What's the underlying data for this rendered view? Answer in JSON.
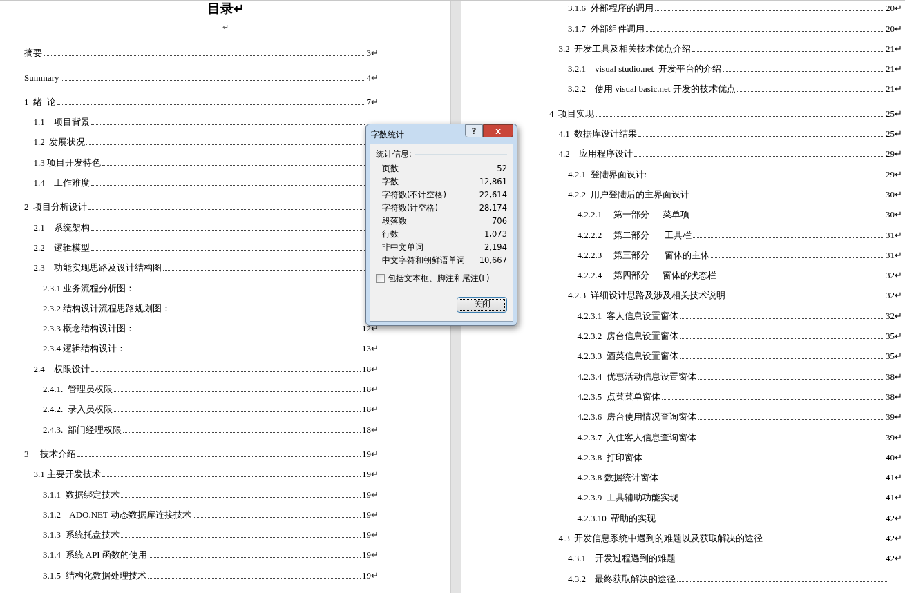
{
  "pages": [
    {
      "title": "目录↵",
      "blank_mark": "↵",
      "entries": [
        {
          "label": "摘要",
          "page": "3↵"
        },
        {
          "label": "Summary",
          "page": "4↵"
        },
        {
          "label": "1  绪  论",
          "page": "7↵",
          "children": [
            {
              "label": "1.1    项目背景"
            },
            {
              "label": "1.2  发展状况"
            },
            {
              "label": "1.3 项目开发特色"
            },
            {
              "label": "1.4    工作难度"
            }
          ]
        },
        {
          "label": "2  项目分析设计",
          "children": [
            {
              "label": "2.1    系统架构"
            },
            {
              "label": "2.2    逻辑模型"
            },
            {
              "label": "2.3    功能实现思路及设计结构图",
              "children": [
                {
                  "label": "2.3.1 业务流程分析图："
                },
                {
                  "label": "2.3.2 结构设计流程思路规划图："
                },
                {
                  "label": "2.3.3 概念结构设计图：",
                  "page": "12↵"
                },
                {
                  "label": "2.3.4 逻辑结构设计：",
                  "page": "13↵"
                }
              ]
            },
            {
              "label": "2.4    权限设计",
              "page": "18↵",
              "children": [
                {
                  "label": "2.4.1.  管理员权限",
                  "page": "18↵"
                },
                {
                  "label": "2.4.2.  录入员权限",
                  "page": "18↵"
                },
                {
                  "label": "2.4.3.  部门经理权限",
                  "page": "18↵"
                }
              ]
            }
          ]
        },
        {
          "label": "3     技术介绍",
          "page": "19↵",
          "children": [
            {
              "label": "3.1 主要开发技术",
              "page": "19↵",
              "children": [
                {
                  "label": "3.1.1  数据绑定技术",
                  "page": "19↵"
                },
                {
                  "label": "3.1.2    ADO.NET 动态数据库连接技术",
                  "page": "19↵"
                },
                {
                  "label": "3.1.3  系统托盘技术",
                  "page": "19↵"
                },
                {
                  "label": "3.1.4  系统 API 函数的使用",
                  "page": "19↵"
                },
                {
                  "label": "3.1.5  结构化数据处理技术",
                  "page": "19↵"
                }
              ]
            }
          ]
        }
      ]
    },
    {
      "entries": [
        {
          "children": [
            {
              "children": [
                {
                  "label": "3.1.6  外部程序的调用",
                  "page": "20↵"
                },
                {
                  "label": "3.1.7  外部组件调用",
                  "page": "20↵"
                }
              ]
            },
            {
              "label": "3.2  开发工具及相关技术优点介绍",
              "page": "21↵",
              "children": [
                {
                  "label": "3.2.1    visual studio.net  开发平台的介绍",
                  "page": "21↵"
                },
                {
                  "label": "3.2.2    使用 visual basic.net 开发的技术优点",
                  "page": "21↵"
                }
              ]
            }
          ]
        },
        {
          "label": "4  项目实现",
          "page": "25↵",
          "children": [
            {
              "label": "4.1  数据库设计结果",
              "page": "25↵"
            },
            {
              "label": "4.2    应用程序设计",
              "page": "29↵",
              "children": [
                {
                  "label": "4.2.1  登陆界面设计:",
                  "page": "29↵"
                },
                {
                  "label": "4.2.2  用户登陆后的主界面设计",
                  "page": "30↵",
                  "children": [
                    {
                      "label": "4.2.2.1     第一部分      菜单项",
                      "page": "30↵"
                    },
                    {
                      "label": "4.2.2.2     第二部分       工具栏",
                      "page": "31↵"
                    },
                    {
                      "label": "4.2.2.3     第三部分       窗体的主体",
                      "page": "31↵"
                    },
                    {
                      "label": "4.2.2.4     第四部分      窗体的状态栏",
                      "page": "32↵"
                    }
                  ]
                },
                {
                  "label": "4.2.3  详细设计思路及涉及相关技术说明",
                  "page": "32↵",
                  "children": [
                    {
                      "label": "4.2.3.1  客人信息设置窗体",
                      "page": "32↵"
                    },
                    {
                      "label": "4.2.3.2  房台信息设置窗体",
                      "page": "35↵"
                    },
                    {
                      "label": "4.2.3.3  酒菜信息设置窗体",
                      "page": "35↵"
                    },
                    {
                      "label": "4.2.3.4  优惠活动信息设置窗体",
                      "page": "38↵"
                    },
                    {
                      "label": "4.2.3.5  点菜菜单窗体",
                      "page": "38↵"
                    },
                    {
                      "label": "4.2.3.6  房台使用情况查询窗体",
                      "page": "39↵"
                    },
                    {
                      "label": "4.2.3.7  入住客人信息查询窗体",
                      "page": "39↵"
                    },
                    {
                      "label": "4.2.3.8  打印窗体",
                      "page": "40↵"
                    },
                    {
                      "label": "4.2.3.8 数据统计窗体",
                      "page": "41↵"
                    },
                    {
                      "label": "4.2.3.9  工具辅助功能实现",
                      "page": "41↵"
                    },
                    {
                      "label": "4.2.3.10  帮助的实现",
                      "page": "42↵"
                    }
                  ]
                }
              ]
            },
            {
              "label": "4.3  开发信息系统中遇到的难题以及获取解决的途径",
              "page": "42↵",
              "children": [
                {
                  "label": "4.3.1    开发过程遇到的难题",
                  "page": "42↵"
                },
                {
                  "label": "4.3.2    最终获取解决的途径"
                }
              ]
            }
          ]
        }
      ]
    }
  ],
  "dialog": {
    "title": "字数统计",
    "help_button": "?",
    "close_button": "x",
    "group_label": "统计信息:",
    "stats": [
      {
        "label": "页数",
        "value": "52"
      },
      {
        "label": "字数",
        "value": "12,861"
      },
      {
        "label": "字符数(不计空格)",
        "value": "22,614"
      },
      {
        "label": "字符数(计空格)",
        "value": "28,174"
      },
      {
        "label": "段落数",
        "value": "706"
      },
      {
        "label": "行数",
        "value": "1,073"
      },
      {
        "label": "非中文单词",
        "value": "2,194"
      },
      {
        "label": "中文字符和朝鲜语单词",
        "value": "10,667"
      }
    ],
    "include_checkbox": {
      "label": "包括文本框、脚注和尾注(F)",
      "checked": false
    },
    "ok_button": "关闭"
  }
}
